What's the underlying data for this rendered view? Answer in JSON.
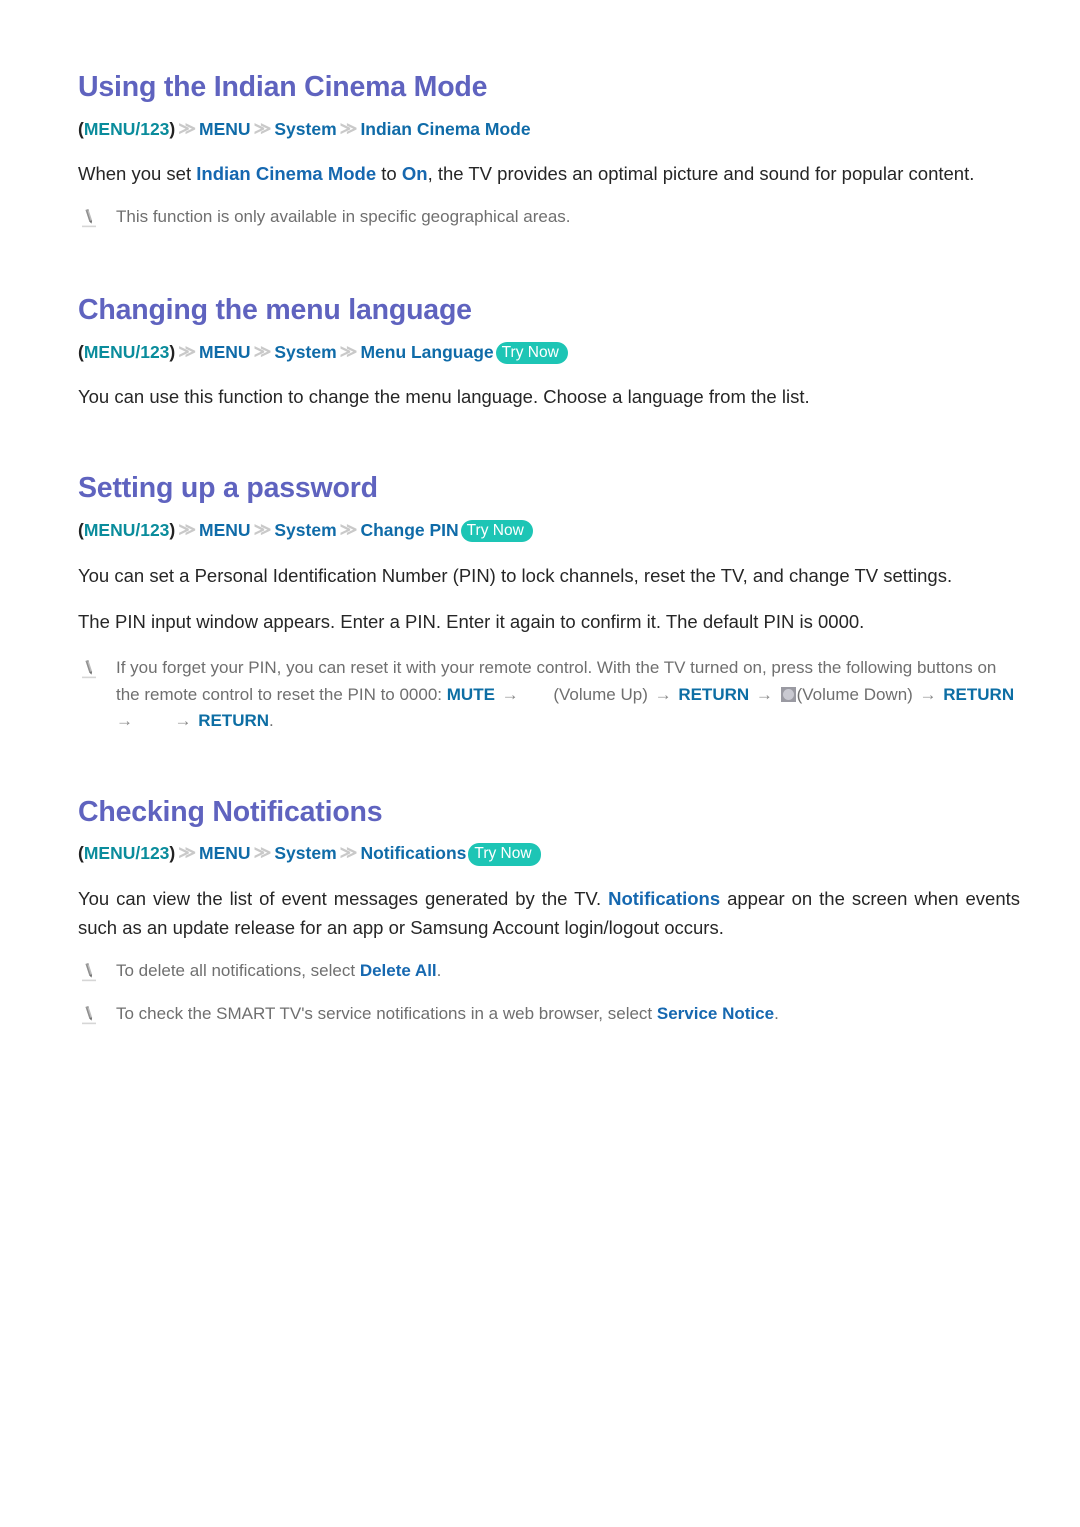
{
  "document": {
    "title": "Samsung Smart TV e-Manual — System settings page"
  },
  "sections": [
    {
      "id": "indian-cinema-mode",
      "heading": "Using the Indian Cinema Mode",
      "breadcrumb": {
        "open_paren": "(",
        "root": "MENU/123",
        "close_paren": ")",
        "separator": "≫",
        "items": [
          "MENU",
          "System",
          "Indian Cinema Mode"
        ],
        "try_now": null
      },
      "paragraphs": [
        {
          "parts": [
            {
              "t": "When you set ",
              "k": "plain"
            },
            {
              "t": "Indian Cinema Mode",
              "k": "link"
            },
            {
              "t": " to ",
              "k": "plain"
            },
            {
              "t": "On",
              "k": "link"
            },
            {
              "t": ", the TV provides an optimal picture and sound for popular content.",
              "k": "plain"
            }
          ]
        }
      ],
      "notes": [
        {
          "icon": "pencil-note-icon",
          "parts": [
            {
              "t": "This function is only available in specific geographical areas.",
              "k": "plain"
            }
          ]
        }
      ]
    },
    {
      "id": "menu-language",
      "heading": "Changing the menu language",
      "breadcrumb": {
        "open_paren": "(",
        "root": "MENU/123",
        "close_paren": ")",
        "separator": "≫",
        "items": [
          "MENU",
          "System",
          "Menu Language"
        ],
        "try_now": "Try Now"
      },
      "paragraphs": [
        {
          "parts": [
            {
              "t": "You can use this function to change the menu language. Choose a language from the list.",
              "k": "plain"
            }
          ]
        }
      ],
      "notes": []
    },
    {
      "id": "setting-password",
      "heading": "Setting up a password",
      "breadcrumb": {
        "open_paren": "(",
        "root": "MENU/123",
        "close_paren": ")",
        "separator": "≫",
        "items": [
          "MENU",
          "System",
          "Change PIN"
        ],
        "try_now": "Try Now"
      },
      "paragraphs": [
        {
          "parts": [
            {
              "t": "You can set a Personal Identification Number (PIN) to lock channels, reset the TV, and change TV settings.",
              "k": "plain"
            }
          ]
        },
        {
          "parts": [
            {
              "t": "The PIN input window appears. Enter a PIN. Enter it again to confirm it. The default PIN is 0000.",
              "k": "plain"
            }
          ]
        }
      ],
      "notes": [
        {
          "icon": "pencil-note-icon",
          "parts": [
            {
              "t": "If you forget your PIN, you can reset it with your remote control. With the TV turned on, press the following buttons on the remote control to reset the PIN to 0000: ",
              "k": "plain"
            },
            {
              "t": "MUTE",
              "k": "key"
            },
            {
              "t": " → ",
              "k": "arrow"
            },
            {
              "t": "",
              "k": "gap"
            },
            {
              "t": "(Volume Up)",
              "k": "plain"
            },
            {
              "t": " → ",
              "k": "arrow"
            },
            {
              "t": "RETURN",
              "k": "key"
            },
            {
              "t": " → ",
              "k": "arrow"
            },
            {
              "t": "",
              "k": "btnicon"
            },
            {
              "t": "(Volume Down)",
              "k": "plain"
            },
            {
              "t": " → ",
              "k": "arrow"
            },
            {
              "t": "RETURN",
              "k": "key"
            },
            {
              "t": " → ",
              "k": "arrow"
            },
            {
              "t": "",
              "k": "gap"
            },
            {
              "t": " → ",
              "k": "arrow"
            },
            {
              "t": "RETURN",
              "k": "key"
            },
            {
              "t": ".",
              "k": "plain"
            }
          ]
        }
      ]
    },
    {
      "id": "checking-notifications",
      "heading": "Checking Notifications",
      "breadcrumb": {
        "open_paren": "(",
        "root": "MENU/123",
        "close_paren": ")",
        "separator": "≫",
        "items": [
          "MENU",
          "System",
          "Notifications"
        ],
        "try_now": "Try Now"
      },
      "paragraphs": [
        {
          "parts": [
            {
              "t": "You can view the list of event messages generated by the TV. ",
              "k": "plain"
            },
            {
              "t": "Notifications",
              "k": "link"
            },
            {
              "t": " appear on the screen when events such as an update release for an app or Samsung Account login/logout occurs.",
              "k": "plain"
            }
          ]
        }
      ],
      "notes": [
        {
          "icon": "pencil-note-icon",
          "parts": [
            {
              "t": "To delete all notifications, select ",
              "k": "plain"
            },
            {
              "t": "Delete All",
              "k": "link"
            },
            {
              "t": ".",
              "k": "plain"
            }
          ]
        },
        {
          "icon": "pencil-note-icon",
          "parts": [
            {
              "t": "To check the SMART TV's service notifications in a web browser, select ",
              "k": "plain"
            },
            {
              "t": "Service Notice",
              "k": "link"
            },
            {
              "t": ".",
              "k": "plain"
            }
          ]
        }
      ]
    }
  ],
  "colors": {
    "heading": "#5f63bf",
    "link": "#1668b0",
    "breadcrumb_root": "#0a8c9c",
    "breadcrumb_item": "#0f6ba8",
    "try_now_bg": "#1dc5b5",
    "try_now_text": "#ffffff",
    "body_text": "#262626",
    "note_text": "#6f6f6f",
    "separator": "#c9c9c9",
    "background": "#ffffff"
  }
}
